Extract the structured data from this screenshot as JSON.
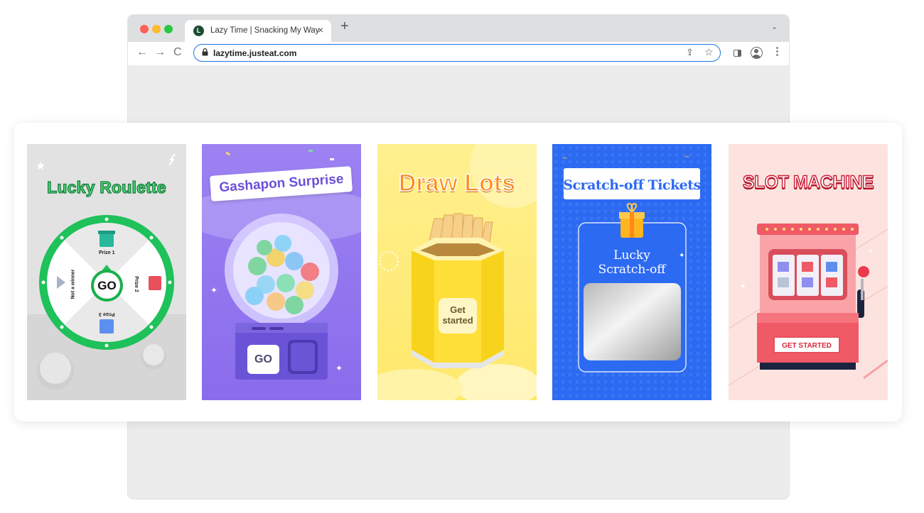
{
  "browser": {
    "tab_title": "Lazy Time | Snacking My Way",
    "tab_close": "×",
    "new_tab": "+",
    "tab_menu": "⌄",
    "favicon_letter": "L",
    "url": "lazytime.justeat.com",
    "nav": {
      "back": "←",
      "forward": "→",
      "reload": "C"
    },
    "icons": {
      "share": "share-icon",
      "star": "star-icon",
      "side_panel": "side-panel-icon",
      "profile": "profile-icon",
      "menu": "kebab-menu-icon"
    },
    "kebab": "⋮"
  },
  "games": [
    {
      "title": "Lucky Roulette",
      "button": "GO",
      "segments": [
        "Prize 1",
        "Prize 2",
        "Prize 3",
        "Not a winner"
      ],
      "colors": {
        "bg": "#e2e2e2",
        "accent": "#1fc15a"
      }
    },
    {
      "title": "Gashapon Surprise",
      "button": "GO",
      "colors": {
        "bg": "#8f72ef",
        "accent": "#6a4fd8"
      }
    },
    {
      "title": "Draw Lots",
      "button": "Get started",
      "colors": {
        "bg": "#ffec7a",
        "accent": "#ff8b1a"
      }
    },
    {
      "title": "Scratch-off Tickets",
      "subtitle_line1": "Lucky",
      "subtitle_line2": "Scratch-off",
      "colors": {
        "bg": "#2d6af2",
        "accent": "#ffffff"
      }
    },
    {
      "title": "SLOT MACHINE",
      "button": "GET STARTED",
      "colors": {
        "bg": "#fde3df",
        "accent": "#e84e5c"
      }
    }
  ]
}
